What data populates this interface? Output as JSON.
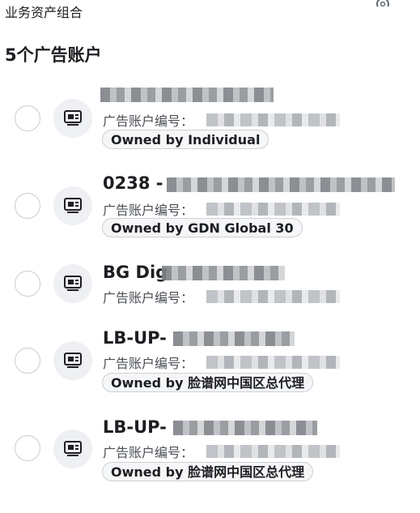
{
  "header": {
    "portfolio_label": "业务资产组合"
  },
  "title": "5个广告账户",
  "accounts": [
    {
      "name": "",
      "id_label": "广告账户编号：",
      "owner": "Owned by Individual"
    },
    {
      "name": "0238 -",
      "id_label": "广告账户编号：",
      "owner": "Owned by GDN Global 30"
    },
    {
      "name": "BG Dig",
      "id_label": "广告账户编号：",
      "owner": ""
    },
    {
      "name": "LB-UP-",
      "id_label": "广告账户编号：",
      "owner": "Owned by 脸谱网中国区总代理"
    },
    {
      "name": "LB-UP-",
      "id_label": "广告账户编号：",
      "owner": "Owned by 脸谱网中国区总代理"
    }
  ]
}
